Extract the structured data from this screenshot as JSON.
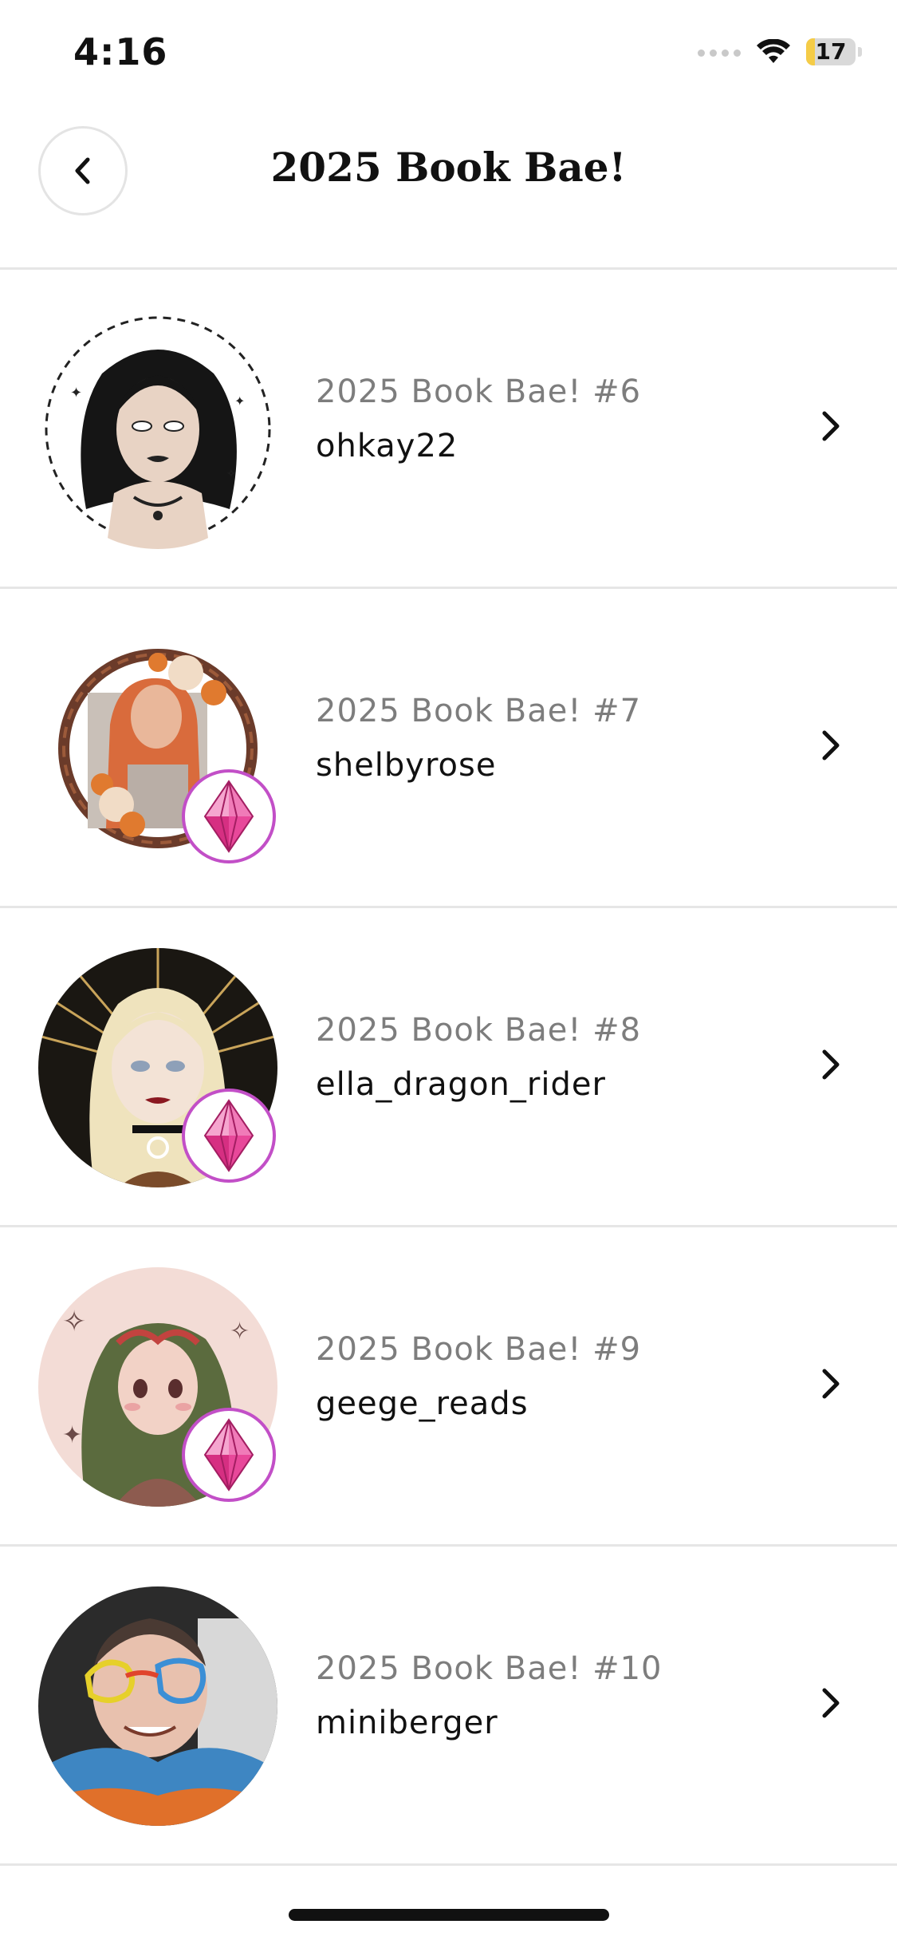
{
  "status_bar": {
    "time": "4:16",
    "battery": "17",
    "battery_level": 0.17
  },
  "header": {
    "title": "2025 Book Bae!",
    "back_icon": "chevron-left-icon"
  },
  "list": [
    {
      "subtitle": "2025 Book Bae! #6",
      "username": "ohkay22",
      "badge": false
    },
    {
      "subtitle": "2025 Book Bae! #7",
      "username": "shelbyrose",
      "badge": true
    },
    {
      "subtitle": "2025 Book Bae! #8",
      "username": "ella_dragon_rider",
      "badge": true
    },
    {
      "subtitle": "2025 Book Bae! #9",
      "username": "geege_reads",
      "badge": true
    },
    {
      "subtitle": "2025 Book Bae! #10",
      "username": "miniberger",
      "badge": false
    }
  ],
  "colors": {
    "badge_border": "#c24fc7",
    "gem": "#e8489a",
    "battery": "#f5cc47"
  }
}
